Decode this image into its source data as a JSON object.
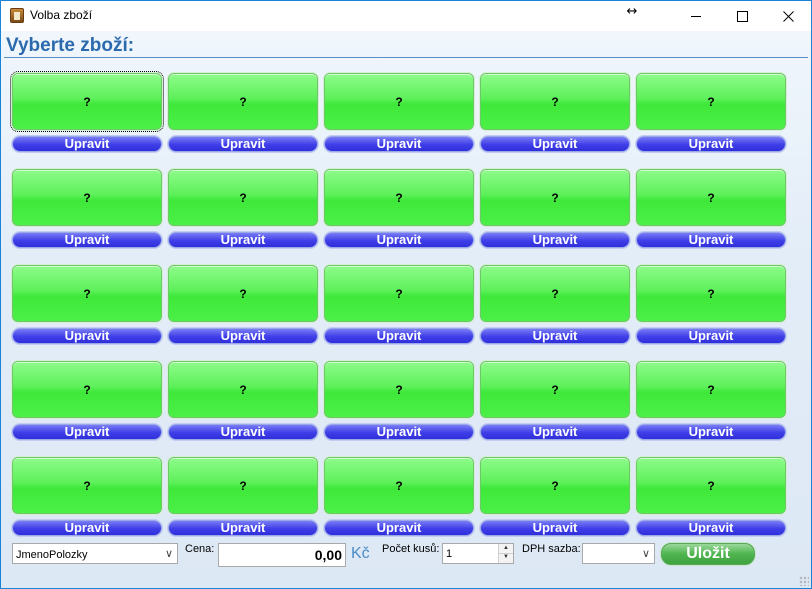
{
  "window": {
    "title": "Volba zboží",
    "resize_glyph": "↔"
  },
  "heading": "Vyberte zboží:",
  "products": [
    {
      "label": "?",
      "edit_label": "Upravit"
    },
    {
      "label": "?",
      "edit_label": "Upravit"
    },
    {
      "label": "?",
      "edit_label": "Upravit"
    },
    {
      "label": "?",
      "edit_label": "Upravit"
    },
    {
      "label": "?",
      "edit_label": "Upravit"
    },
    {
      "label": "?",
      "edit_label": "Upravit"
    },
    {
      "label": "?",
      "edit_label": "Upravit"
    },
    {
      "label": "?",
      "edit_label": "Upravit"
    },
    {
      "label": "?",
      "edit_label": "Upravit"
    },
    {
      "label": "?",
      "edit_label": "Upravit"
    },
    {
      "label": "?",
      "edit_label": "Upravit"
    },
    {
      "label": "?",
      "edit_label": "Upravit"
    },
    {
      "label": "?",
      "edit_label": "Upravit"
    },
    {
      "label": "?",
      "edit_label": "Upravit"
    },
    {
      "label": "?",
      "edit_label": "Upravit"
    },
    {
      "label": "?",
      "edit_label": "Upravit"
    },
    {
      "label": "?",
      "edit_label": "Upravit"
    },
    {
      "label": "?",
      "edit_label": "Upravit"
    },
    {
      "label": "?",
      "edit_label": "Upravit"
    },
    {
      "label": "?",
      "edit_label": "Upravit"
    },
    {
      "label": "?",
      "edit_label": "Upravit"
    },
    {
      "label": "?",
      "edit_label": "Upravit"
    },
    {
      "label": "?",
      "edit_label": "Upravit"
    },
    {
      "label": "?",
      "edit_label": "Upravit"
    },
    {
      "label": "?",
      "edit_label": "Upravit"
    }
  ],
  "bottom_bar": {
    "item_name": "JmenoPolozky",
    "price_label": "Cena:",
    "price_value": "0,00",
    "currency": "Kč",
    "quantity_label": "Počet kusů:",
    "quantity_value": "1",
    "vat_label": "DPH sazba:",
    "vat_value": "",
    "save_label": "Uložit"
  },
  "colors": {
    "product_button": "#4ef04a",
    "edit_button": "#3535e0",
    "heading": "#2a6aad",
    "save_button": "#4fb54f",
    "window_border": "#1883d7"
  },
  "icons": {
    "app": "app-icon",
    "minimize": "minimize-icon",
    "maximize": "maximize-icon",
    "close": "close-icon",
    "dropdown": "chevron-down-icon"
  }
}
